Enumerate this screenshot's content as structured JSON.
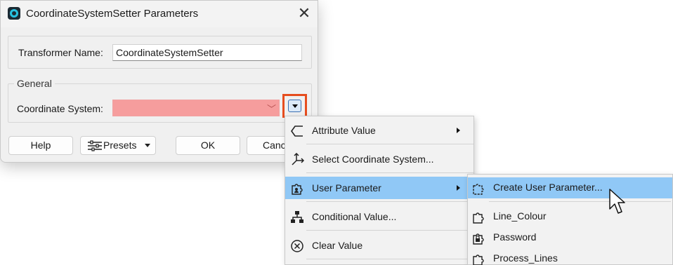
{
  "dialog": {
    "title": "CoordinateSystemSetter Parameters",
    "app_icon": "fme-workbench-icon",
    "close_icon": "close-icon",
    "transformer_name_label": "Transformer Name:",
    "transformer_name_value": "CoordinateSystemSetter",
    "general_legend": "General",
    "coordinate_system_label": "Coordinate System:",
    "coordinate_system_value": "",
    "coordinate_system_status_color": "#f69d9d",
    "buttons": {
      "help": "Help",
      "presets": "Presets",
      "ok": "OK",
      "cancel": "Canc"
    }
  },
  "menu": {
    "items": [
      {
        "label": "Attribute Value",
        "icon": "attribute-value-icon",
        "has_submenu": true
      },
      {
        "label": "Select Coordinate System...",
        "icon": "coordinate-axes-icon",
        "has_submenu": false
      },
      {
        "label": "User Parameter",
        "icon": "user-parameter-icon",
        "has_submenu": true,
        "highlighted": true
      },
      {
        "label": "Conditional Value...",
        "icon": "conditional-tree-icon",
        "has_submenu": false
      },
      {
        "label": "Clear Value",
        "icon": "clear-circle-x-icon",
        "has_submenu": false
      }
    ]
  },
  "submenu": {
    "items": [
      {
        "label": "Create User Parameter...",
        "icon": "puzzle-plus-icon",
        "highlighted": true
      },
      {
        "label": "Line_Colour",
        "icon": "puzzle-icon"
      },
      {
        "label": "Password",
        "icon": "puzzle-lock-icon"
      },
      {
        "label": "Process_Lines",
        "icon": "puzzle-icon"
      }
    ]
  },
  "colors": {
    "highlight": "#90c8f6",
    "focus_outline": "#e64d1e",
    "invalid_field": "#f69d9d"
  }
}
